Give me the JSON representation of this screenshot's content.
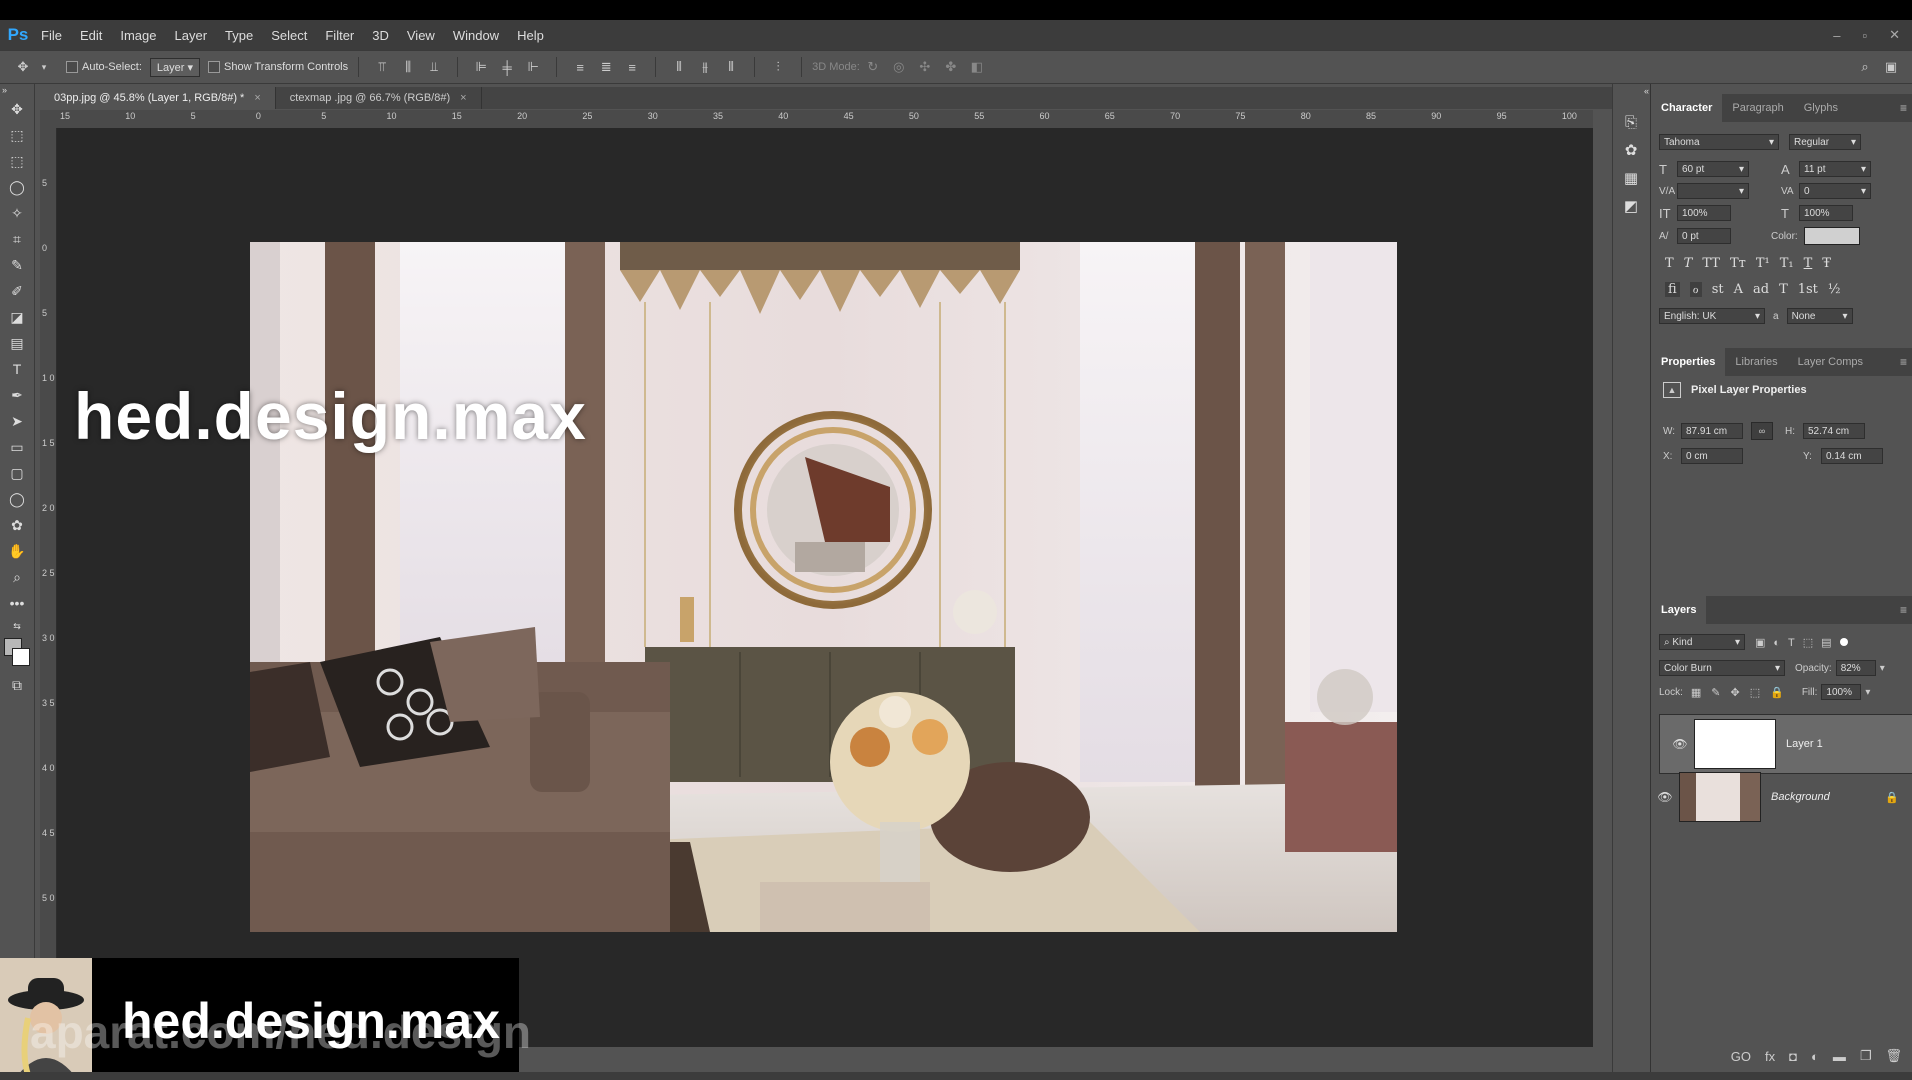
{
  "app": {
    "logo": "Ps"
  },
  "menu": [
    "File",
    "Edit",
    "Image",
    "Layer",
    "Type",
    "Select",
    "Filter",
    "3D",
    "View",
    "Window",
    "Help"
  ],
  "window_controls": [
    "–",
    "▫",
    "✕"
  ],
  "options": {
    "auto_select": "Auto-Select:",
    "auto_select_value": "Layer",
    "show_transform": "Show Transform Controls",
    "mode3d": "3D Mode:"
  },
  "tabs": [
    {
      "label": "03pp.jpg @ 45.8% (Layer 1, RGB/8#) *",
      "active": true
    },
    {
      "label": "ctexmap .jpg @ 66.7% (RGB/8#)",
      "active": false
    }
  ],
  "ruler_h": [
    "15",
    "10",
    "5",
    "0",
    "5",
    "10",
    "15",
    "20",
    "25",
    "30",
    "35",
    "40",
    "45",
    "50",
    "55",
    "60",
    "65",
    "70",
    "75",
    "80",
    "85",
    "90",
    "95",
    "100"
  ],
  "ruler_v": [
    "5",
    "0",
    "5",
    "1 0",
    "1 5",
    "2 0",
    "2 5",
    "3 0",
    "3 5",
    "4 0",
    "4 5",
    "5 0"
  ],
  "watermark": {
    "top": "hed.design.max",
    "bottom": "hed.design.max",
    "url": "aparat.com/hed.design"
  },
  "character": {
    "tabs": [
      "Character",
      "Paragraph",
      "Glyphs"
    ],
    "font": "Tahoma",
    "style": "Regular",
    "size": "60 pt",
    "leading": "11 pt",
    "kerning": "",
    "tracking": "0",
    "vscale": "100%",
    "hscale": "100%",
    "baseline": "0 pt",
    "color_label": "Color:",
    "language": "English: UK",
    "antialias": "None",
    "aa_label": "a",
    "style_glyphs": [
      "T",
      "T",
      "TT",
      "Tт",
      "T¹",
      "T₁",
      "T",
      "Ŧ"
    ],
    "ot_glyphs": [
      "fi",
      "ℴ",
      "st",
      "A",
      "ad",
      "T",
      "1st",
      "½"
    ]
  },
  "properties": {
    "tabs": [
      "Properties",
      "Libraries",
      "Layer Comps"
    ],
    "title": "Pixel Layer Properties",
    "w_label": "W:",
    "w": "87.91 cm",
    "h_label": "H:",
    "h": "52.74 cm",
    "x_label": "X:",
    "x": "0 cm",
    "y_label": "Y:",
    "y": "0.14 cm"
  },
  "layers": {
    "tab": "Layers",
    "kind": "Kind",
    "blend": "Color Burn",
    "opacity_label": "Opacity:",
    "opacity": "82%",
    "lock_label": "Lock:",
    "fill_label": "Fill:",
    "fill": "100%",
    "items": [
      {
        "name": "Layer 1",
        "selected": true
      },
      {
        "name": "Background",
        "selected": false
      }
    ]
  },
  "bottom_icons": [
    "GO",
    "fx",
    "◘",
    "◐",
    "▬",
    "❐",
    "🗑"
  ]
}
